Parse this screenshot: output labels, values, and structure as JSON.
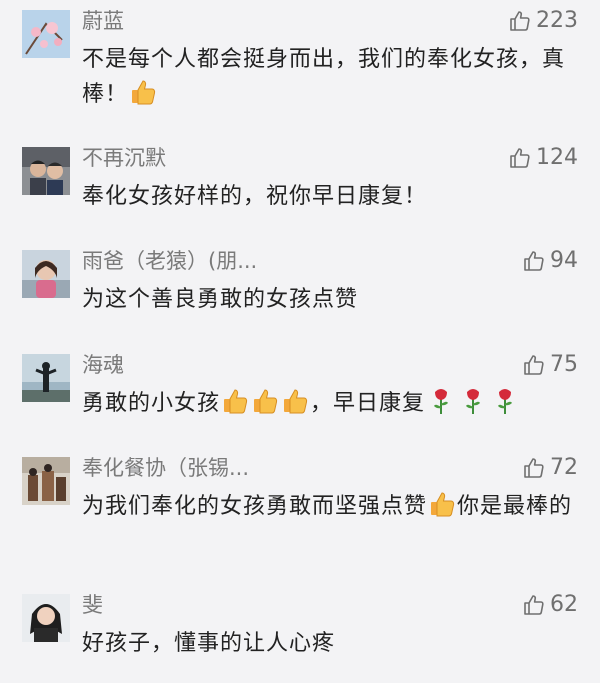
{
  "comments": [
    {
      "user": "蔚蓝",
      "likes": "223",
      "text_a": "不是每个人都会挺身而出，我们的奉化女孩，真棒！"
    },
    {
      "user": "不再沉默",
      "likes": "124",
      "text_a": "奉化女孩好样的，祝你早日康复！"
    },
    {
      "user": "雨爸（老猿）(朋...",
      "likes": "94",
      "text_a": "为这个善良勇敢的女孩点赞"
    },
    {
      "user": "海魂",
      "likes": "75",
      "text_a": "勇敢的小女孩",
      "text_b": "，早日康复"
    },
    {
      "user": "奉化餐协（张锡...",
      "likes": "72",
      "text_a": "为我们奉化的女孩勇敢而坚强点赞",
      "text_b": "你是最棒的"
    },
    {
      "user": "斐",
      "likes": "62",
      "text_a": "好孩子，懂事的让人心疼"
    }
  ]
}
